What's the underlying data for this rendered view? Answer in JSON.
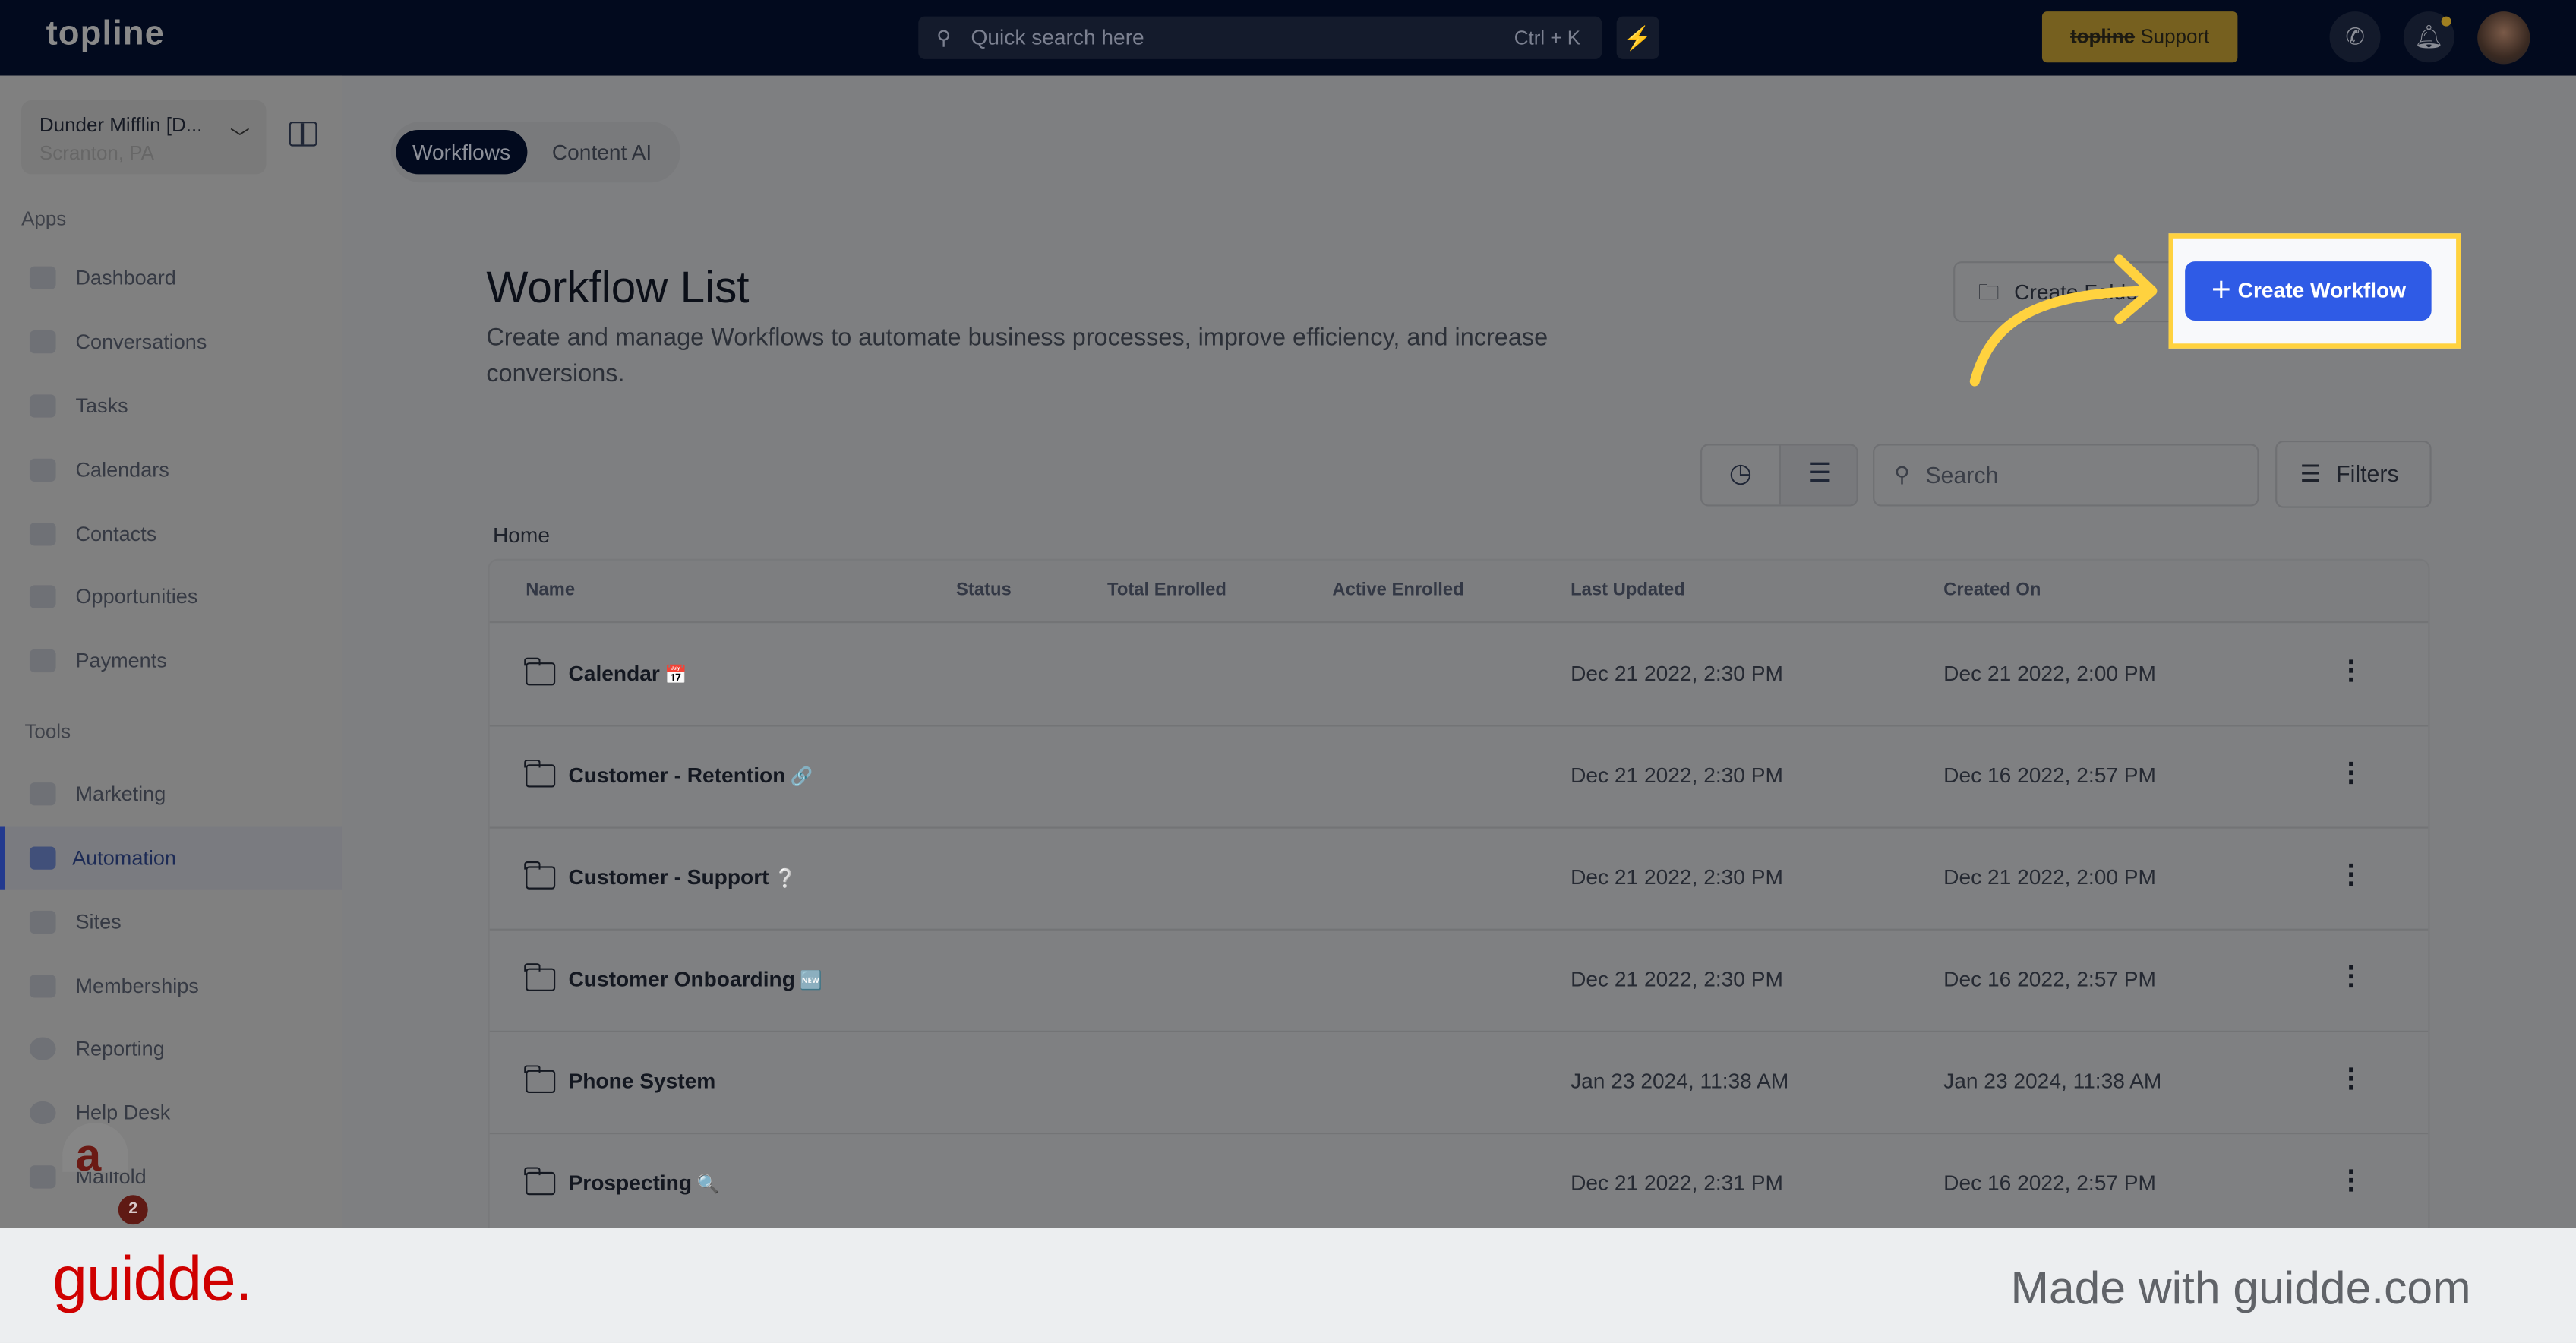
{
  "header": {
    "logo": "topline",
    "search_placeholder": "Quick search here",
    "search_shortcut": "Ctrl + K",
    "support_brand": "topline",
    "support_label": "Support"
  },
  "sidebar": {
    "account_name": "Dunder Mifflin [D...",
    "account_location": "Scranton, PA",
    "apps_label": "Apps",
    "tools_label": "Tools",
    "apps": [
      {
        "label": "Dashboard"
      },
      {
        "label": "Conversations"
      },
      {
        "label": "Tasks"
      },
      {
        "label": "Calendars"
      },
      {
        "label": "Contacts"
      },
      {
        "label": "Opportunities"
      },
      {
        "label": "Payments"
      }
    ],
    "tools": [
      {
        "label": "Marketing"
      },
      {
        "label": "Automation",
        "active": true
      },
      {
        "label": "Sites"
      },
      {
        "label": "Memberships"
      },
      {
        "label": "Reporting"
      },
      {
        "label": "Help Desk"
      },
      {
        "label": "Mailfold"
      }
    ],
    "notification_count": "2"
  },
  "tabs": [
    {
      "label": "Workflows",
      "active": true
    },
    {
      "label": "Content AI"
    }
  ],
  "main": {
    "title": "Workflow List",
    "description": "Create and manage Workflows to automate business processes, improve efficiency, and increase conversions.",
    "create_folder_label": "Create Folder",
    "create_workflow_label": "Create Workflow",
    "search_placeholder": "Search",
    "filters_label": "Filters",
    "breadcrumb": "Home"
  },
  "table": {
    "columns": [
      "Name",
      "Status",
      "Total Enrolled",
      "Active Enrolled",
      "Last Updated",
      "Created On"
    ],
    "rows": [
      {
        "name": "Calendar",
        "emoji": "📅",
        "updated": "Dec 21 2022, 2:30 PM",
        "created": "Dec 21 2022, 2:00 PM"
      },
      {
        "name": "Customer - Retention",
        "emoji": "🔗",
        "updated": "Dec 21 2022, 2:30 PM",
        "created": "Dec 16 2022, 2:57 PM"
      },
      {
        "name": "Customer - Support",
        "emoji": "❔",
        "updated": "Dec 21 2022, 2:30 PM",
        "created": "Dec 21 2022, 2:00 PM"
      },
      {
        "name": "Customer Onboarding",
        "emoji": "🆕",
        "updated": "Dec 21 2022, 2:30 PM",
        "created": "Dec 16 2022, 2:57 PM"
      },
      {
        "name": "Phone System",
        "emoji": "",
        "updated": "Jan 23 2024, 11:38 AM",
        "created": "Jan 23 2024, 11:38 AM"
      },
      {
        "name": "Prospecting",
        "emoji": "🔍",
        "updated": "Dec 21 2022, 2:31 PM",
        "created": "Dec 16 2022, 2:57 PM"
      }
    ]
  },
  "footer": {
    "brand": "guidde.",
    "made_with": "Made with guidde.com"
  },
  "colors": {
    "topbar": "#020a1e",
    "primary": "#2f5be6",
    "highlight": "#ffd23f",
    "brand_red": "#cf0000"
  }
}
